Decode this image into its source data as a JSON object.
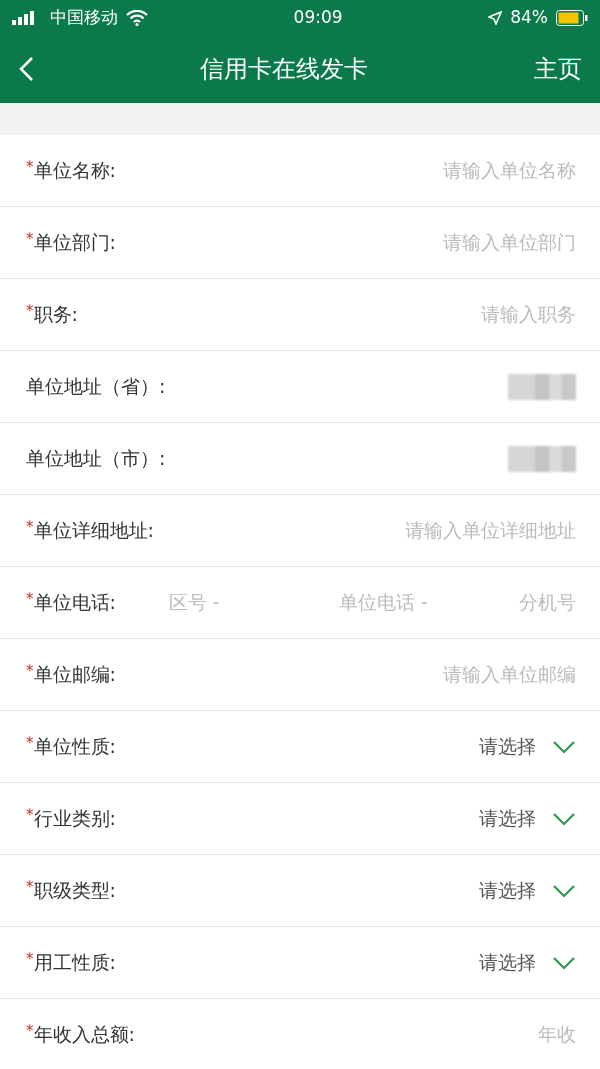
{
  "status_bar": {
    "carrier": "中国移动",
    "time": "09:09",
    "battery": "84%"
  },
  "nav": {
    "title": "信用卡在线发卡",
    "home": "主页"
  },
  "rows": [
    {
      "kind": "input",
      "mark": "*",
      "label": "单位名称:",
      "placeholder": "请输入单位名称"
    },
    {
      "kind": "input",
      "mark": "*",
      "label": "单位部门:",
      "placeholder": "请输入单位部门"
    },
    {
      "kind": "input",
      "mark": "*",
      "label": "职务:",
      "placeholder": "请输入职务"
    },
    {
      "kind": "blurred",
      "label": "单位地址（省）:"
    },
    {
      "kind": "blurred",
      "label": "单位地址（市）:"
    },
    {
      "kind": "input",
      "mark": "*",
      "label": "单位详细地址:",
      "placeholder": "请输入单位详细地址"
    },
    {
      "kind": "phone",
      "mark": "*",
      "label": "单位电话:",
      "parts": [
        {
          "placeholder": "区号 -"
        },
        {
          "placeholder": "单位电话 -"
        },
        {
          "placeholder": "分机号"
        }
      ]
    },
    {
      "kind": "input",
      "mark": "*",
      "label": "单位邮编:",
      "placeholder": "请输入单位邮编"
    },
    {
      "kind": "select",
      "mark": "*",
      "label": "单位性质:",
      "placeholder": "请选择"
    },
    {
      "kind": "select",
      "mark": "*",
      "label": "行业类别:",
      "placeholder": "请选择"
    },
    {
      "kind": "select",
      "mark": "*",
      "label": "职级类型:",
      "placeholder": "请选择"
    },
    {
      "kind": "select",
      "mark": "*",
      "label": "用工性质:",
      "placeholder": "请选择"
    },
    {
      "kind": "input",
      "mark": "*",
      "label": "年收入总额:",
      "placeholder": "年收"
    }
  ]
}
